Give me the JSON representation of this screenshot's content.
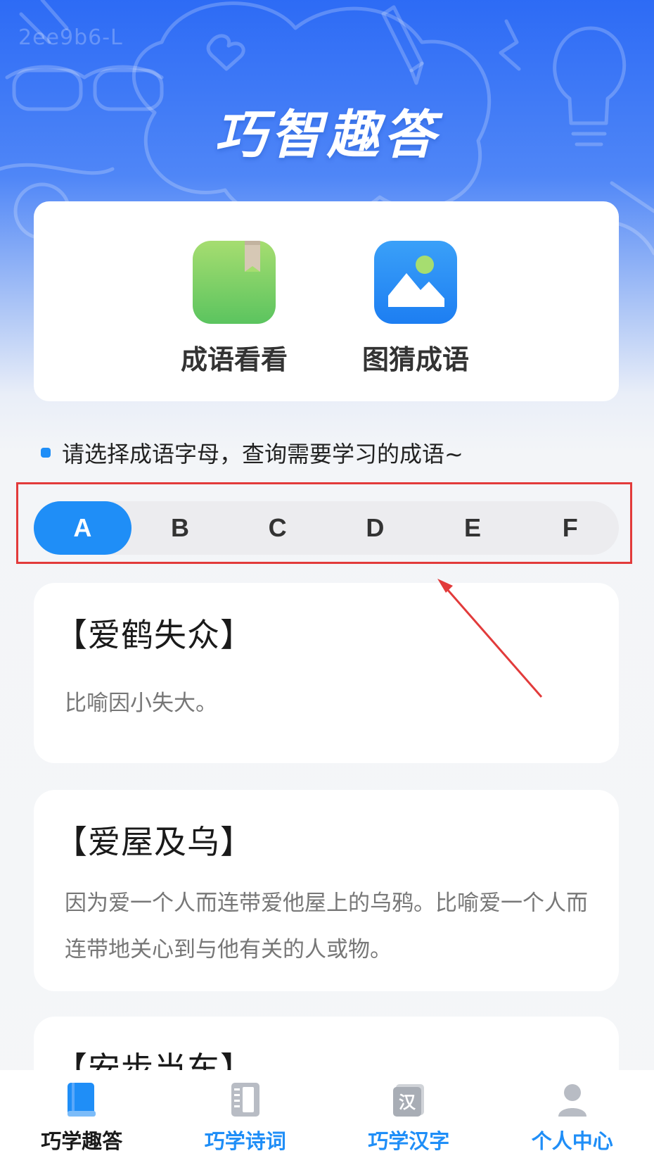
{
  "watermark": "2ee9b6-L",
  "app_title": "巧智趣答",
  "features": [
    {
      "label": "成语看看",
      "icon": "green-book-icon"
    },
    {
      "label": "图猜成语",
      "icon": "picture-icon"
    }
  ],
  "hint": "请选择成语字母，查询需要学习的成语~",
  "letters": [
    "A",
    "B",
    "C",
    "D",
    "E",
    "F"
  ],
  "selected_letter": "A",
  "idioms": [
    {
      "title": "【爱鹤失众】",
      "desc": "比喻因小失大。"
    },
    {
      "title": "【爱屋及乌】",
      "desc": "因为爱一个人而连带爱他屋上的乌鸦。比喻爱一个人而连带地关心到与他有关的人或物。"
    },
    {
      "title": "【安步当车】",
      "desc": ""
    }
  ],
  "tabs": [
    {
      "label": "巧学趣答",
      "icon": "book-icon",
      "active": true
    },
    {
      "label": "巧学诗词",
      "icon": "notebook-icon",
      "active": false
    },
    {
      "label": "巧学汉字",
      "icon": "han-character-icon",
      "glyph": "汉",
      "active": false
    },
    {
      "label": "个人中心",
      "icon": "person-icon",
      "active": false
    }
  ],
  "colors": {
    "accent": "#1f8ef7",
    "annotation": "#e23b3b",
    "tab_active_text": "#1a1a1a",
    "tab_inactive_text": "#1f8ef7"
  }
}
